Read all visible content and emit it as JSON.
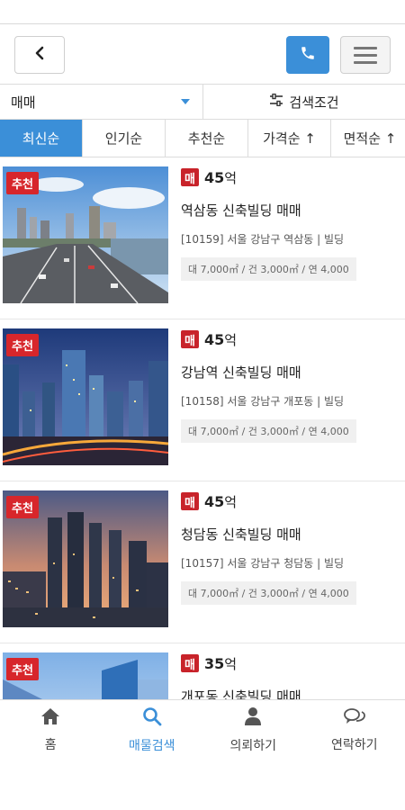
{
  "header": {
    "back_icon": "chevron-left-icon",
    "phone_icon": "phone-icon",
    "menu_icon": "hamburger-menu-icon",
    "accent_color": "#3b8fd8"
  },
  "filter": {
    "deal_type": "매매",
    "search_condition_label": "검색조건"
  },
  "sort_tabs": [
    {
      "label": "최신순",
      "active": true
    },
    {
      "label": "인기순",
      "active": false
    },
    {
      "label": "추천순",
      "active": false
    },
    {
      "label": "가격순 ↑",
      "active": false
    },
    {
      "label": "면적순 ↑",
      "active": false
    }
  ],
  "listings": [
    {
      "badge": "추천",
      "deal_tag": "매",
      "price": "45",
      "price_unit": "억",
      "title": "역삼동 신축빌딩 매매",
      "address": "[10159] 서울 강남구 역삼동 | 빌딩",
      "spec": "대 7,000㎡ / 건 3,000㎡ / 연 4,000",
      "image": "highway-city-photo"
    },
    {
      "badge": "추천",
      "deal_tag": "매",
      "price": "45",
      "price_unit": "억",
      "title": "강남역 신축빌딩 매매",
      "address": "[10158] 서울 강남구 개포동 | 빌딩",
      "spec": "대 7,000㎡ / 건 3,000㎡ / 연 4,000",
      "image": "night-skyline-photo"
    },
    {
      "badge": "추천",
      "deal_tag": "매",
      "price": "45",
      "price_unit": "억",
      "title": "청담동 신축빌딩 매매",
      "address": "[10157] 서울 강남구 청담동 | 빌딩",
      "spec": "대 7,000㎡ / 건 3,000㎡ / 연 4,000",
      "image": "sunset-towers-photo"
    },
    {
      "badge": "추천",
      "deal_tag": "매",
      "price": "35",
      "price_unit": "억",
      "title": "개포동 신축빌딩 매매",
      "address": "",
      "spec": "",
      "image": "glass-building-photo"
    }
  ],
  "bottom_nav": [
    {
      "label": "홈",
      "icon": "home-icon",
      "active": false
    },
    {
      "label": "매물검색",
      "icon": "search-icon",
      "active": true
    },
    {
      "label": "의뢰하기",
      "icon": "user-icon",
      "active": false
    },
    {
      "label": "연락하기",
      "icon": "chat-icon",
      "active": false
    }
  ]
}
